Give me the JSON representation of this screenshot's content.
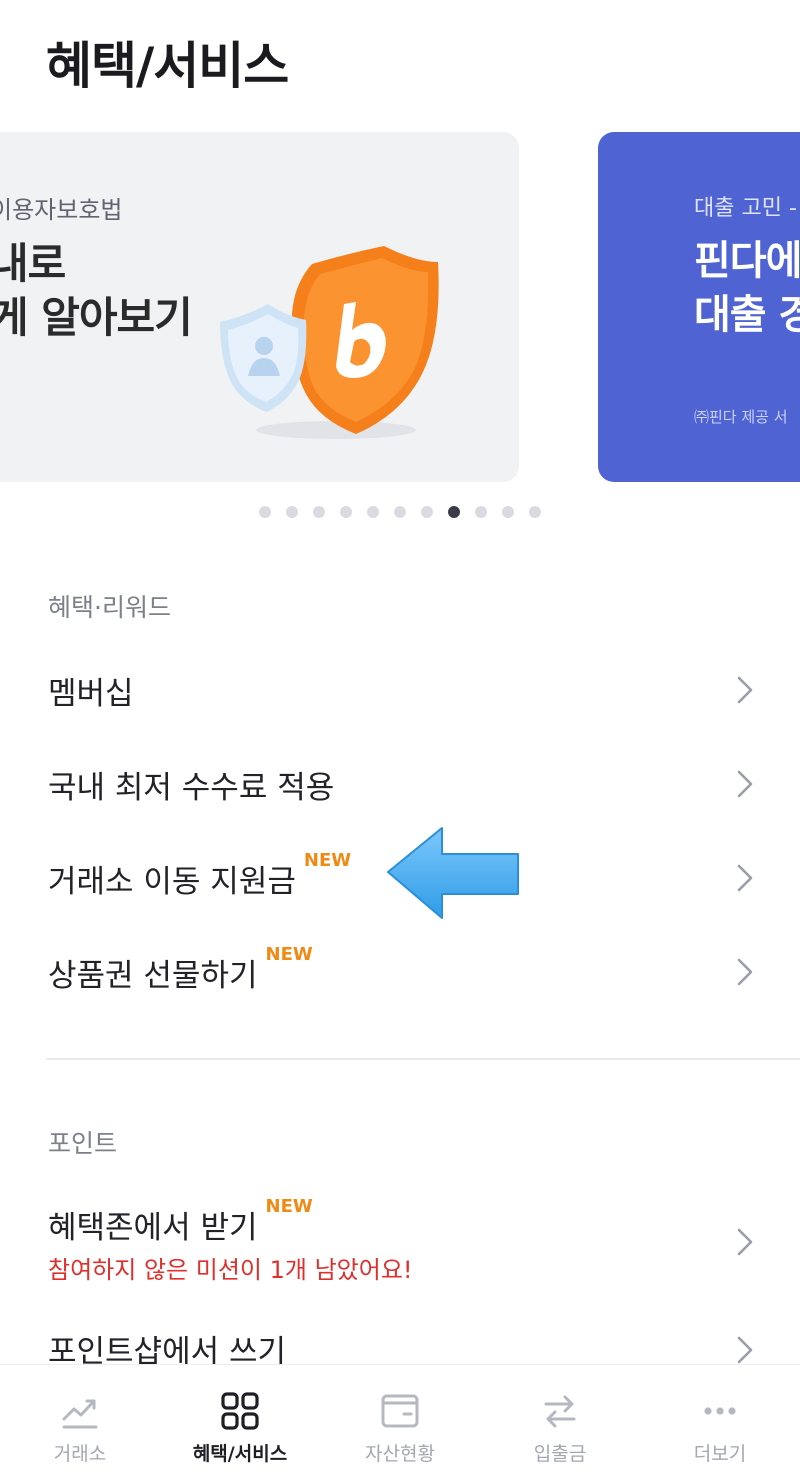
{
  "header": {
    "title": "혜택/서비스"
  },
  "carousel": {
    "banner_1": {
      "subtitle": "이용자보호법",
      "line_1": "내로",
      "line_2": "게 알아보기"
    },
    "banner_2": {
      "subtitle": "대출 고민 -",
      "line_1": "핀다에",
      "line_2": "대출 경",
      "footnote": "㈜핀다 제공 서"
    },
    "dot_count": 11,
    "active_index": 7
  },
  "benefits": {
    "section_label": "혜택·리워드",
    "items": [
      {
        "label": "멤버십",
        "badge": ""
      },
      {
        "label": "국내 최저 수수료 적용",
        "badge": ""
      },
      {
        "label": "거래소 이동 지원금",
        "badge": "NEW"
      },
      {
        "label": "상품권 선물하기",
        "badge": "NEW"
      }
    ]
  },
  "points": {
    "section_label": "포인트",
    "items": [
      {
        "label": "혜택존에서 받기",
        "badge": "NEW",
        "sub": "참여하지 않은 미션이 1개 남았어요!"
      },
      {
        "label": "포인트샵에서 쓰기",
        "badge": ""
      }
    ]
  },
  "bottom_nav": {
    "items": [
      {
        "label": "거래소",
        "icon": "chart-trend-icon"
      },
      {
        "label": "혜택/서비스",
        "icon": "grid-icon",
        "active": true
      },
      {
        "label": "자산현황",
        "icon": "wallet-icon"
      },
      {
        "label": "입출금",
        "icon": "transfer-arrows-icon"
      },
      {
        "label": "더보기",
        "icon": "more-dots-icon"
      }
    ]
  },
  "colors": {
    "accent_new": "#f08a14",
    "alert_red": "#e0302d",
    "banner_blue": "#4f64d2",
    "annotation_arrow": "#3aa9f0"
  }
}
